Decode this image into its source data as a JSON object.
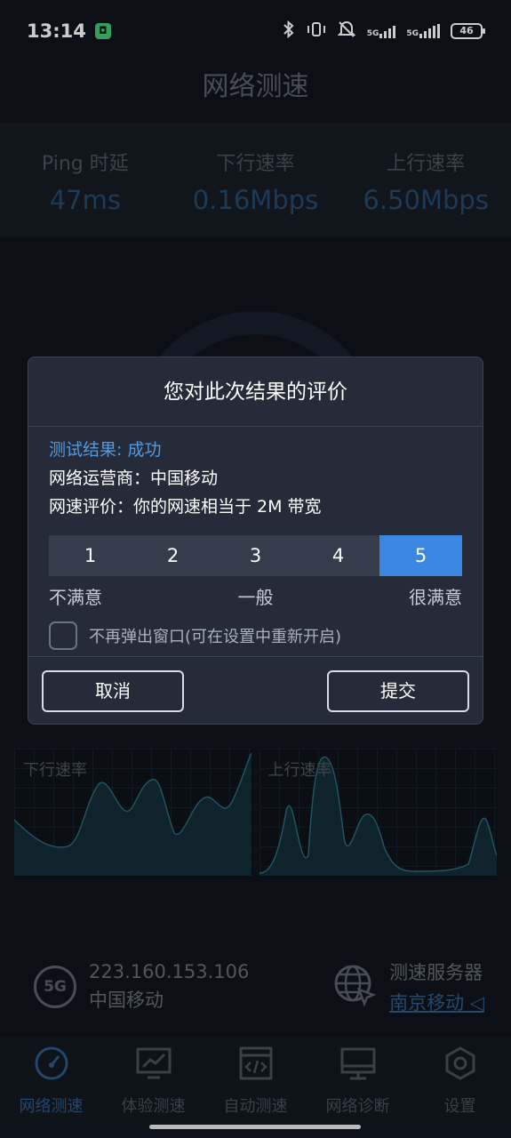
{
  "status_bar": {
    "time": "13:14",
    "battery": "46",
    "network_label_1": "5G",
    "network_label_2": "5G"
  },
  "header": {
    "title": "网络测速"
  },
  "metrics": [
    {
      "label": "Ping 时延",
      "value": "47ms"
    },
    {
      "label": "下行速率",
      "value": "0.16Mbps"
    },
    {
      "label": "上行速率",
      "value": "6.50Mbps"
    }
  ],
  "charts": {
    "download_title": "下行速率",
    "upload_title": "上行速率"
  },
  "connection": {
    "badge": "5G",
    "ip": "223.160.153.106",
    "carrier": "中国移动",
    "server_label": "测速服务器",
    "server_value": "南京移动 ◁"
  },
  "bottom_nav": [
    {
      "label": "网络测速",
      "icon": "speedometer-icon",
      "active": true
    },
    {
      "label": "体验测速",
      "icon": "monitor-chart-icon",
      "active": false
    },
    {
      "label": "自动测速",
      "icon": "code-window-icon",
      "active": false
    },
    {
      "label": "网络诊断",
      "icon": "desktop-icon",
      "active": false
    },
    {
      "label": "设置",
      "icon": "settings-hexagon-icon",
      "active": false
    }
  ],
  "dialog": {
    "title": "您对此次结果的评价",
    "result": "测试结果: 成功",
    "operator": "网络运营商：中国移动",
    "speed_eval": "网速评价：你的网速相当于 2M 带宽",
    "rating_options": [
      "1",
      "2",
      "3",
      "4",
      "5"
    ],
    "selected_rating": "5",
    "scale_low": "不满意",
    "scale_mid": "一般",
    "scale_high": "很满意",
    "dont_show_label": "不再弹出窗口(可在设置中重新开启)",
    "dont_show_checked": false,
    "cancel_label": "取消",
    "submit_label": "提交"
  }
}
